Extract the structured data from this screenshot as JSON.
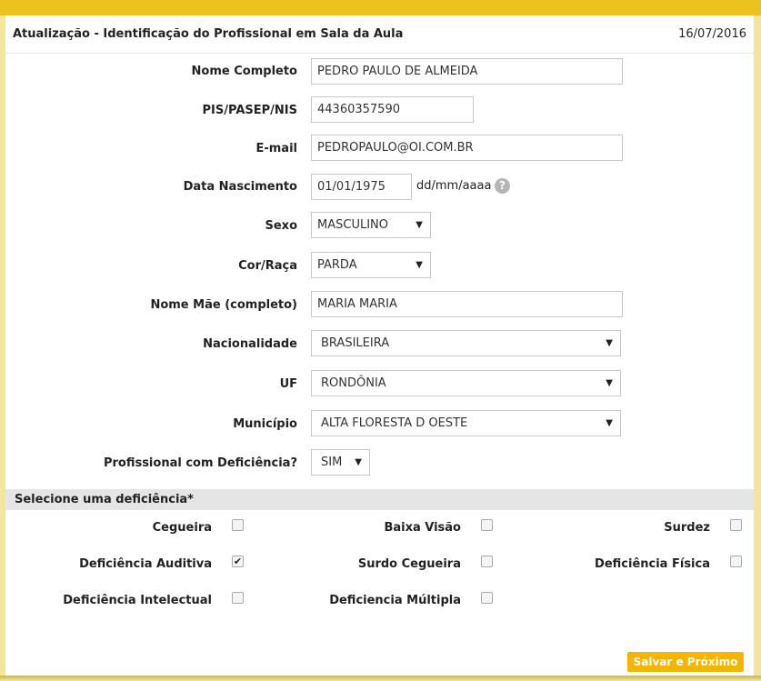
{
  "header": {
    "title": "Atualização - Identificação do Profissional em Sala da Aula",
    "date": "16/07/2016"
  },
  "form": {
    "nome_label": "Nome Completo",
    "nome_value": "PEDRO PAULO DE ALMEIDA",
    "pis_label": "PIS/PASEP/NIS",
    "pis_value": "44360357590",
    "email_label": "E-mail",
    "email_value": "PEDROPAULO@OI.COM.BR",
    "nasc_label": "Data Nascimento",
    "nasc_value": "01/01/1975",
    "nasc_hint": "dd/mm/aaaa",
    "help_icon": "?",
    "sexo_label": "Sexo",
    "sexo_value": "MASCULINO",
    "cor_label": "Cor/Raça",
    "cor_value": "PARDA",
    "mae_label": "Nome Mãe (completo)",
    "mae_value": "MARIA MARIA",
    "nac_label": "Nacionalidade",
    "nac_value": "BRASILEIRA",
    "uf_label": "UF",
    "uf_value": "RONDÔNIA",
    "mun_label": "Município",
    "mun_value": "ALTA FLORESTA D OESTE",
    "def_label": "Profissional com Deficiência?",
    "def_value": "SIM",
    "caret": "▼"
  },
  "deficiencias": {
    "section_title": "Selecione uma deficiência*",
    "items": [
      {
        "label": "Cegueira",
        "mark": ""
      },
      {
        "label": "Baixa Visão",
        "mark": ""
      },
      {
        "label": "Surdez",
        "mark": ""
      },
      {
        "label": "Deficiência Auditiva",
        "mark": "✔"
      },
      {
        "label": "Surdo Cegueira",
        "mark": ""
      },
      {
        "label": "Deficiência Física",
        "mark": ""
      },
      {
        "label": "Deficiência Intelectual",
        "mark": ""
      },
      {
        "label": "Deficiencia Múltipla",
        "mark": ""
      }
    ]
  },
  "actions": {
    "save_next": "Salvar e Próximo"
  },
  "colors": {
    "accent": "#ecc21f",
    "button": "#f5b400",
    "background": "#f3e59a"
  }
}
